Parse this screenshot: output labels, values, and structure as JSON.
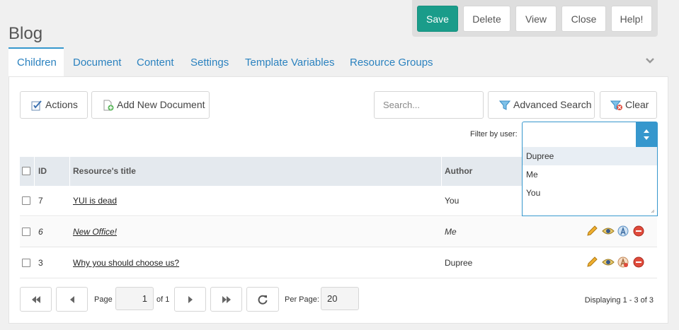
{
  "page": {
    "title": "Blog"
  },
  "actions": {
    "save": "Save",
    "delete": "Delete",
    "view": "View",
    "close": "Close",
    "help": "Help!"
  },
  "tabs": [
    {
      "label": "Children",
      "active": true
    },
    {
      "label": "Document",
      "active": false
    },
    {
      "label": "Content",
      "active": false
    },
    {
      "label": "Settings",
      "active": false
    },
    {
      "label": "Template Variables",
      "active": false
    },
    {
      "label": "Resource Groups",
      "active": false
    }
  ],
  "toolbar": {
    "actions_label": "Actions",
    "add_label": "Add New Document",
    "search_placeholder": "Search...",
    "advanced_search_label": "Advanced Search",
    "clear_label": "Clear",
    "filter_label": "Filter by user:",
    "filter_value": "",
    "filter_options": [
      "Dupree",
      "Me",
      "You"
    ]
  },
  "grid": {
    "columns": {
      "id": "ID",
      "title": "Resource's title",
      "author": "Author"
    },
    "rows": [
      {
        "id": "7",
        "title": "YUI is dead",
        "author": "You",
        "italic": false
      },
      {
        "id": "6",
        "title": "New Office!",
        "author": "Me",
        "italic": true
      },
      {
        "id": "3",
        "title": "Why you should choose us?",
        "author": "Dupree",
        "italic": false
      }
    ]
  },
  "pagination": {
    "page_label": "Page",
    "page_value": "1",
    "of_label": "of 1",
    "per_page_label": "Per Page:",
    "per_page_value": "20",
    "displaying": "Displaying 1 - 3 of 3"
  },
  "colors": {
    "accent": "#1a9c8a",
    "link": "#2b82bf",
    "focus": "#3697cd"
  }
}
